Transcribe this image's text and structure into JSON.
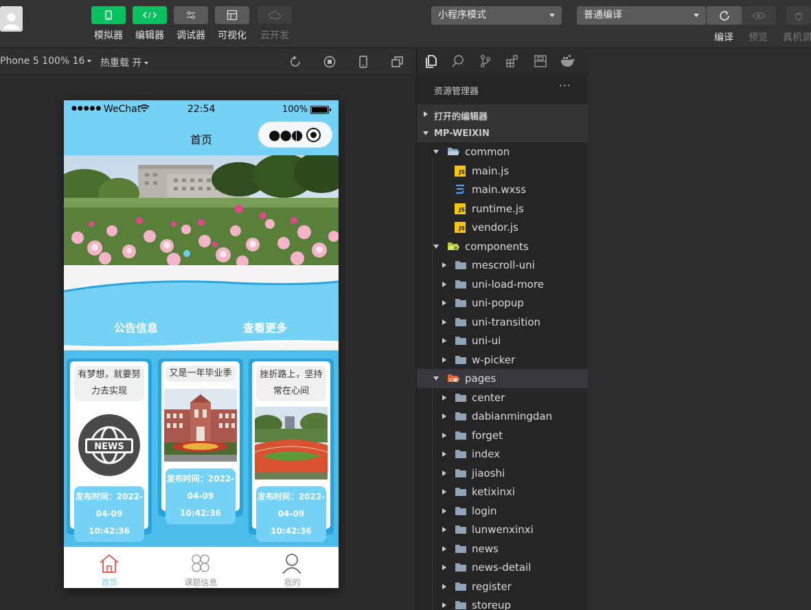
{
  "toolbar": {
    "tools": [
      {
        "label": "模拟器",
        "icon": "phone-icon"
      },
      {
        "label": "编辑器",
        "icon": "code-icon"
      },
      {
        "label": "调试器",
        "icon": "sliders-icon"
      },
      {
        "label": "可视化",
        "icon": "layout-icon"
      },
      {
        "label": "云开发",
        "icon": "cloud-icon"
      }
    ],
    "mode_select": "小程序模式",
    "compile_select": "普通编译",
    "actions": {
      "compile": "编译",
      "preview": "预览",
      "debug": "真机调"
    }
  },
  "simbar": {
    "device": "Phone 5 100% 16",
    "hot_reload": "热重载 开"
  },
  "phone": {
    "status": {
      "carrier": "WeChat",
      "time": "22:54",
      "battery": "100%"
    },
    "nav_title": "首页",
    "notice": {
      "left": "公告信息",
      "right": "查看更多"
    },
    "cards": [
      {
        "title": "有梦想，就要努力去实现",
        "time": "发布时间：2022-04-09 10:42:36",
        "image": "news-globe-icon"
      },
      {
        "title": "又是一年毕业季",
        "time": "发布时间：2022-04-09 10:42:36",
        "image": "campus-building-photo"
      },
      {
        "title": "挫折路上，坚持常在心间",
        "time": "发布时间：2022-04-09 10:42:36",
        "image": "sports-field-photo"
      }
    ],
    "tabs": [
      {
        "label": "首页",
        "icon": "home-icon"
      },
      {
        "label": "课题信息",
        "icon": "grid-icon"
      },
      {
        "label": "我的",
        "icon": "user-icon"
      }
    ]
  },
  "explorer": {
    "title": "资源管理器",
    "more": "···",
    "sections": {
      "open_editors": "打开的编辑器",
      "project": "MP-WEIXIN"
    },
    "tree": [
      {
        "label": "common",
        "depth": 1,
        "kind": "folder-open"
      },
      {
        "label": "main.js",
        "depth": 2,
        "kind": "js"
      },
      {
        "label": "main.wxss",
        "depth": 2,
        "kind": "css"
      },
      {
        "label": "runtime.js",
        "depth": 2,
        "kind": "js"
      },
      {
        "label": "vendor.js",
        "depth": 2,
        "kind": "js"
      },
      {
        "label": "components",
        "depth": 1,
        "kind": "folder-open-special"
      },
      {
        "label": "mescroll-uni",
        "depth": 2,
        "kind": "folder"
      },
      {
        "label": "uni-load-more",
        "depth": 2,
        "kind": "folder"
      },
      {
        "label": "uni-popup",
        "depth": 2,
        "kind": "folder"
      },
      {
        "label": "uni-transition",
        "depth": 2,
        "kind": "folder"
      },
      {
        "label": "uni-ui",
        "depth": 2,
        "kind": "folder"
      },
      {
        "label": "w-picker",
        "depth": 2,
        "kind": "folder"
      },
      {
        "label": "pages",
        "depth": 1,
        "kind": "folder-open-pages"
      },
      {
        "label": "center",
        "depth": 2,
        "kind": "folder"
      },
      {
        "label": "dabianmingdan",
        "depth": 2,
        "kind": "folder"
      },
      {
        "label": "forget",
        "depth": 2,
        "kind": "folder"
      },
      {
        "label": "index",
        "depth": 2,
        "kind": "folder"
      },
      {
        "label": "jiaoshi",
        "depth": 2,
        "kind": "folder"
      },
      {
        "label": "ketixinxi",
        "depth": 2,
        "kind": "folder"
      },
      {
        "label": "login",
        "depth": 2,
        "kind": "folder"
      },
      {
        "label": "lunwenxinxi",
        "depth": 2,
        "kind": "folder"
      },
      {
        "label": "news",
        "depth": 2,
        "kind": "folder"
      },
      {
        "label": "news-detail",
        "depth": 2,
        "kind": "folder"
      },
      {
        "label": "register",
        "depth": 2,
        "kind": "folder"
      },
      {
        "label": "storeup",
        "depth": 2,
        "kind": "folder"
      }
    ]
  },
  "colors": {
    "accent_green": "#07c160",
    "phone_blue": "#74d2f6",
    "card_blue": "#2aa3dc"
  }
}
